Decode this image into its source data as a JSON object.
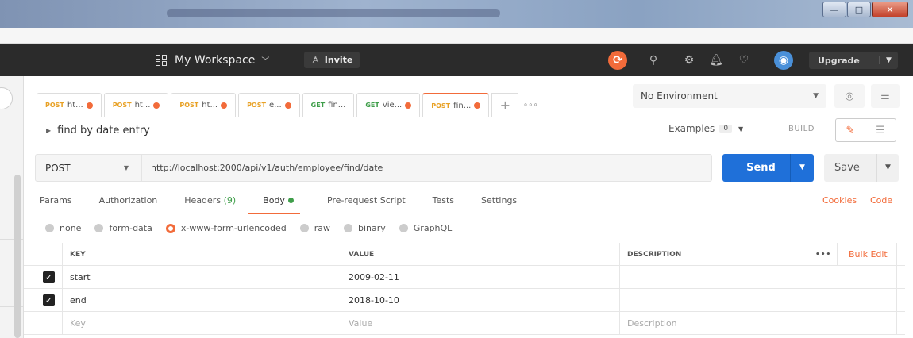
{
  "window": {
    "minimize": "—",
    "maximize": "□",
    "close": "✕"
  },
  "header": {
    "workspace_label": "My Workspace",
    "invite_label": "Invite",
    "upgrade_label": "Upgrade"
  },
  "tabs": [
    {
      "method": "POST",
      "name": "ht...",
      "unsaved": true,
      "active": false
    },
    {
      "method": "POST",
      "name": "ht...",
      "unsaved": true,
      "active": false
    },
    {
      "method": "POST",
      "name": "ht...",
      "unsaved": true,
      "active": false
    },
    {
      "method": "POST",
      "name": "e...",
      "unsaved": true,
      "active": false
    },
    {
      "method": "GET",
      "name": "fin...",
      "unsaved": false,
      "active": false
    },
    {
      "method": "GET",
      "name": "vie...",
      "unsaved": true,
      "active": false
    },
    {
      "method": "POST",
      "name": "fin...",
      "unsaved": true,
      "active": true
    }
  ],
  "environment": {
    "selected": "No Environment"
  },
  "request": {
    "name": "find by date entry",
    "examples_label": "Examples",
    "examples_count": "0",
    "build_label": "BUILD",
    "method": "POST",
    "url": "http://localhost:2000/api/v1/auth/employee/find/date",
    "send_label": "Send",
    "save_label": "Save"
  },
  "subtabs": {
    "params": "Params",
    "authorization": "Authorization",
    "headers": "Headers",
    "headers_count": "(9)",
    "body": "Body",
    "prerequest": "Pre-request Script",
    "tests": "Tests",
    "settings": "Settings",
    "cookies": "Cookies",
    "code": "Code"
  },
  "body_types": {
    "none": "none",
    "form_data": "form-data",
    "urlencoded": "x-www-form-urlencoded",
    "raw": "raw",
    "binary": "binary",
    "graphql": "GraphQL",
    "selected": "x-www-form-urlencoded"
  },
  "table": {
    "headers": {
      "key": "KEY",
      "value": "VALUE",
      "description": "DESCRIPTION",
      "bulk_edit": "Bulk Edit",
      "more": "•••"
    },
    "rows": [
      {
        "checked": true,
        "key": "start",
        "value": "2009-02-11",
        "description": ""
      },
      {
        "checked": true,
        "key": "end",
        "value": "2018-10-10",
        "description": ""
      }
    ],
    "placeholder": {
      "key": "Key",
      "value": "Value",
      "description": "Description"
    }
  },
  "colors": {
    "accent": "#f26b3a",
    "send": "#1f70d9",
    "post": "#e8a125",
    "get": "#3f9e4a",
    "header_bg": "#2b2b2b"
  }
}
